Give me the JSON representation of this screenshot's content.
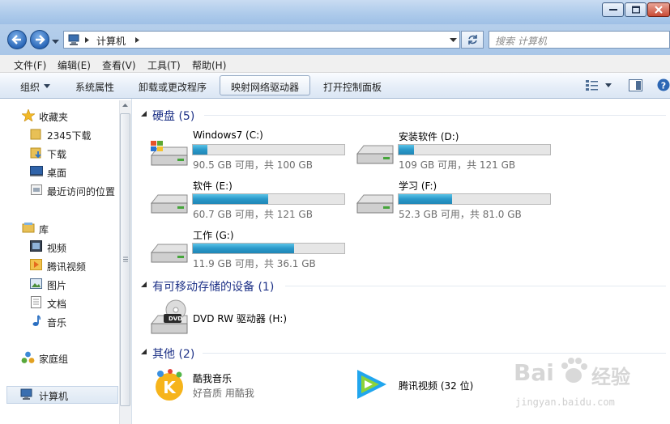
{
  "address": {
    "path_label": "计算机",
    "search_placeholder": "搜索 计算机"
  },
  "menu": [
    "文件(F)",
    "编辑(E)",
    "查看(V)",
    "工具(T)",
    "帮助(H)"
  ],
  "commands": {
    "organize": "组织",
    "system_properties": "系统属性",
    "uninstall": "卸载或更改程序",
    "map_drive": "映射网络驱动器",
    "control_panel": "打开控制面板"
  },
  "nav": {
    "favorites": "收藏夹",
    "fav_items": [
      "2345下载",
      "下载",
      "桌面",
      "最近访问的位置"
    ],
    "libraries": "库",
    "lib_items": [
      "视频",
      "腾讯视频",
      "图片",
      "文档",
      "音乐"
    ],
    "homegroup": "家庭组",
    "computer": "计算机"
  },
  "groups": {
    "hard_disks": "硬盘 (5)",
    "removable": "有可移动存储的设备 (1)",
    "other": "其他 (2)"
  },
  "drives": [
    {
      "name": "Windows7 (C:)",
      "size": "90.5 GB 可用，共 100 GB",
      "used_fraction": 0.095
    },
    {
      "name": "安装软件 (D:)",
      "size": "109 GB 可用，共 121 GB",
      "used_fraction": 0.099
    },
    {
      "name": "软件 (E:)",
      "size": "60.7 GB 可用，共 121 GB",
      "used_fraction": 0.498
    },
    {
      "name": "学习 (F:)",
      "size": "52.3 GB 可用，共 81.0 GB",
      "used_fraction": 0.354
    },
    {
      "name": "工作 (G:)",
      "size": "11.9 GB 可用，共 36.1 GB",
      "used_fraction": 0.67
    }
  ],
  "dvd": {
    "name": "DVD RW 驱动器 (H:)",
    "icon_label": "DVD"
  },
  "other_items": [
    {
      "name": "酷我音乐",
      "subtitle": "好音质 用酷我"
    },
    {
      "name": "腾讯视频 (32 位)"
    }
  ],
  "watermark": {
    "brand": "Bai",
    "brand2": "经验",
    "url": "jingyan.baidu.com"
  }
}
